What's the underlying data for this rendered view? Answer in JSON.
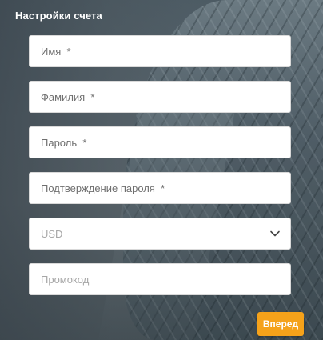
{
  "form": {
    "title": "Настройки счета",
    "fields": {
      "first_name": {
        "placeholder": "Имя  *",
        "value": ""
      },
      "last_name": {
        "placeholder": "Фамилия  *",
        "value": ""
      },
      "password": {
        "placeholder": "Пароль  *",
        "value": ""
      },
      "password_confirm": {
        "placeholder": "Подтверждение пароля  *",
        "value": ""
      },
      "currency": {
        "selected": "USD"
      },
      "promo": {
        "placeholder": "Промокод",
        "value": ""
      }
    },
    "next_button": "Вперед"
  },
  "colors": {
    "accent": "#f5a21a",
    "field_bg": "#ffffff",
    "title": "#ffffff"
  },
  "icons": {
    "currency_dropdown": "chevron-down-icon"
  }
}
